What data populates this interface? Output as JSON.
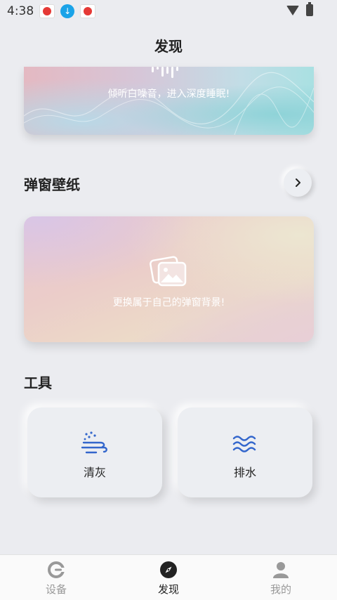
{
  "status_bar": {
    "time": "4:38",
    "icons": [
      "app-badge-icon",
      "download-icon",
      "app-badge-icon",
      "wifi-icon",
      "battery-icon"
    ]
  },
  "header": {
    "title": "发现"
  },
  "white_noise": {
    "text": "倾听白噪音，进入深度睡眠!"
  },
  "popup_wallpaper": {
    "title": "弹窗壁纸",
    "more_icon": "chevron-right-icon",
    "card_text": "更换属于自己的弹窗背景!",
    "card_icon": "images-icon"
  },
  "tools": {
    "title": "工具",
    "items": [
      {
        "label": "清灰",
        "icon": "dust-clean-icon",
        "color": "#3366cc"
      },
      {
        "label": "排水",
        "icon": "water-drain-icon",
        "color": "#3366cc"
      }
    ]
  },
  "bottom_nav": {
    "items": [
      {
        "label": "设备",
        "icon": "device-icon",
        "active": false
      },
      {
        "label": "发现",
        "icon": "compass-icon",
        "active": true
      },
      {
        "label": "我的",
        "icon": "user-icon",
        "active": false
      }
    ]
  },
  "colors": {
    "background": "#ebecf0",
    "accent": "#3366cc",
    "nav_active": "#222222",
    "nav_inactive": "#999999"
  }
}
